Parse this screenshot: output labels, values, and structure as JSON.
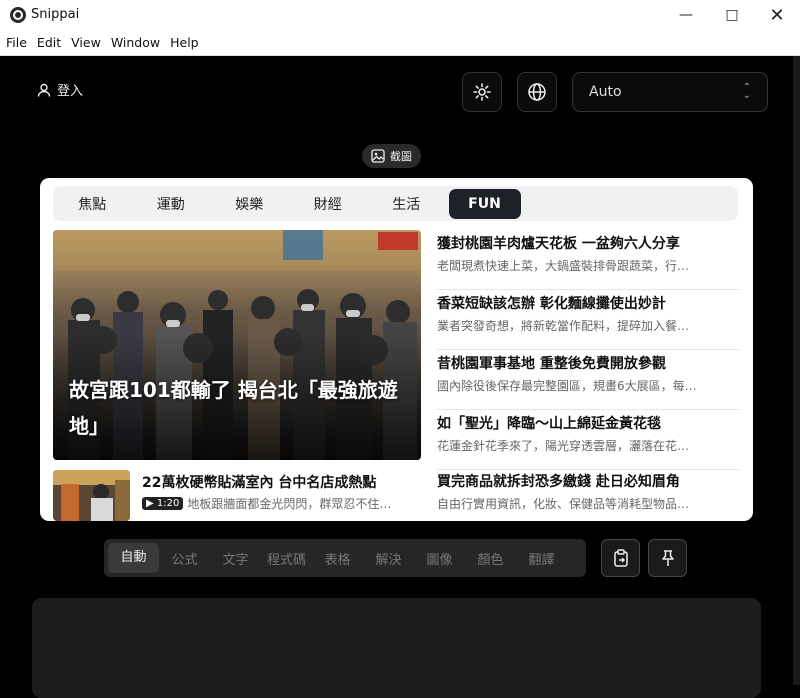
{
  "window": {
    "title": "Snippai"
  },
  "menu": [
    "File",
    "Edit",
    "View",
    "Window",
    "Help"
  ],
  "header": {
    "login_label": "登入",
    "language_select": "Auto"
  },
  "screenshot_chip": "截圖",
  "card": {
    "tabs": [
      "焦點",
      "運動",
      "娛樂",
      "財經",
      "生活",
      "FUN"
    ],
    "hero_caption": "故宮跟101都輸了 揭台北「最強旅遊地」",
    "news": [
      {
        "title": "獲封桃園羊肉爐天花板 一盆夠六人分享",
        "summary": "老闆現煮快速上菜，大鍋盛裝排骨跟蔬菜，行…"
      },
      {
        "title": "香菜短缺該怎辦 彰化麵線攤使出妙計",
        "summary": "業者突發奇想，將新乾當作配料，提碎加入餐…"
      },
      {
        "title": "昔桃園軍事基地 重整後免費開放參觀",
        "summary": "國內除役後保存最完整園區，規畫6大展區，每…"
      },
      {
        "title": "如「聖光」降臨～山上綿延金黃花毯",
        "summary": "花蓮金針花季來了，陽光穿透雲層，灑落在花…"
      },
      {
        "title": "買完商品就拆封恐多繳錢 赴日必知眉角",
        "summary": "自由行實用資訊，化妝、保健品等消耗型物品…"
      }
    ],
    "bottom_news": {
      "title": "22萬枚硬幣貼滿室內 台中名店成熱點",
      "duration": "▶ 1:20",
      "summary": "地板跟牆面都金光閃閃，群眾忍不住…"
    }
  },
  "modes": [
    "自動",
    "公式",
    "文字",
    "程式碼",
    "表格",
    "解決",
    "圖像",
    "顏色",
    "翻譯"
  ]
}
